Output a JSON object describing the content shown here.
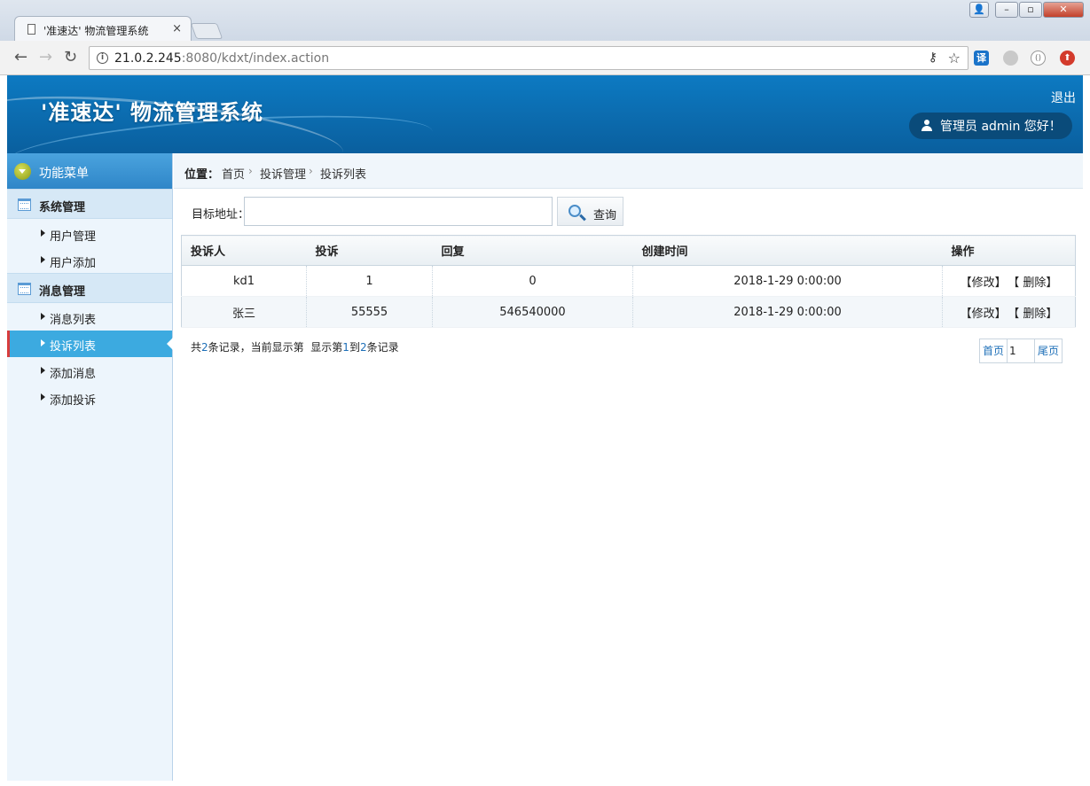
{
  "browser": {
    "tab_title": "'准速达' 物流管理系统",
    "tab_close": "×",
    "url_host": "21.0.2.245",
    "url_rest": ":8080/kdxt/index.action",
    "translate_ext": "译"
  },
  "header": {
    "title": "'准速达' 物流管理系统",
    "logout": "退出",
    "user_greeting": "管理员 admin 您好！"
  },
  "sidebar": {
    "menu_title": "功能菜单",
    "groups": [
      {
        "label": "系统管理",
        "items": [
          "用户管理",
          "用户添加"
        ]
      },
      {
        "label": "消息管理",
        "items": [
          "消息列表",
          "投诉列表",
          "添加消息",
          "添加投诉"
        ]
      }
    ],
    "active_item": "投诉列表"
  },
  "breadcrumb": {
    "prefix": "位置：",
    "items": [
      "首页",
      "投诉管理",
      "投诉列表"
    ],
    "separator": "›"
  },
  "search": {
    "label": "目标地址：",
    "value": "",
    "button": "查询"
  },
  "table": {
    "columns": [
      "投诉人",
      "投诉",
      "回复",
      "创建时间",
      "操作"
    ],
    "rows": [
      {
        "complainant": "kd1",
        "complaint": "1",
        "reply": "0",
        "created": "2018-1-29 0:00:00"
      },
      {
        "complainant": "张三",
        "complaint": "55555",
        "reply": "546540000",
        "created": "2018-1-29 0:00:00"
      }
    ],
    "edit_label": "【修改】",
    "delete_label": "【 删除】"
  },
  "paging": {
    "text_pre": "共",
    "total": "2",
    "text_mid": "条记录，当前显示第  显示第",
    "from": "1",
    "text_to": "到",
    "to": "2",
    "text_post": "条记录",
    "first": "首页",
    "page": "1",
    "last": "尾页"
  }
}
